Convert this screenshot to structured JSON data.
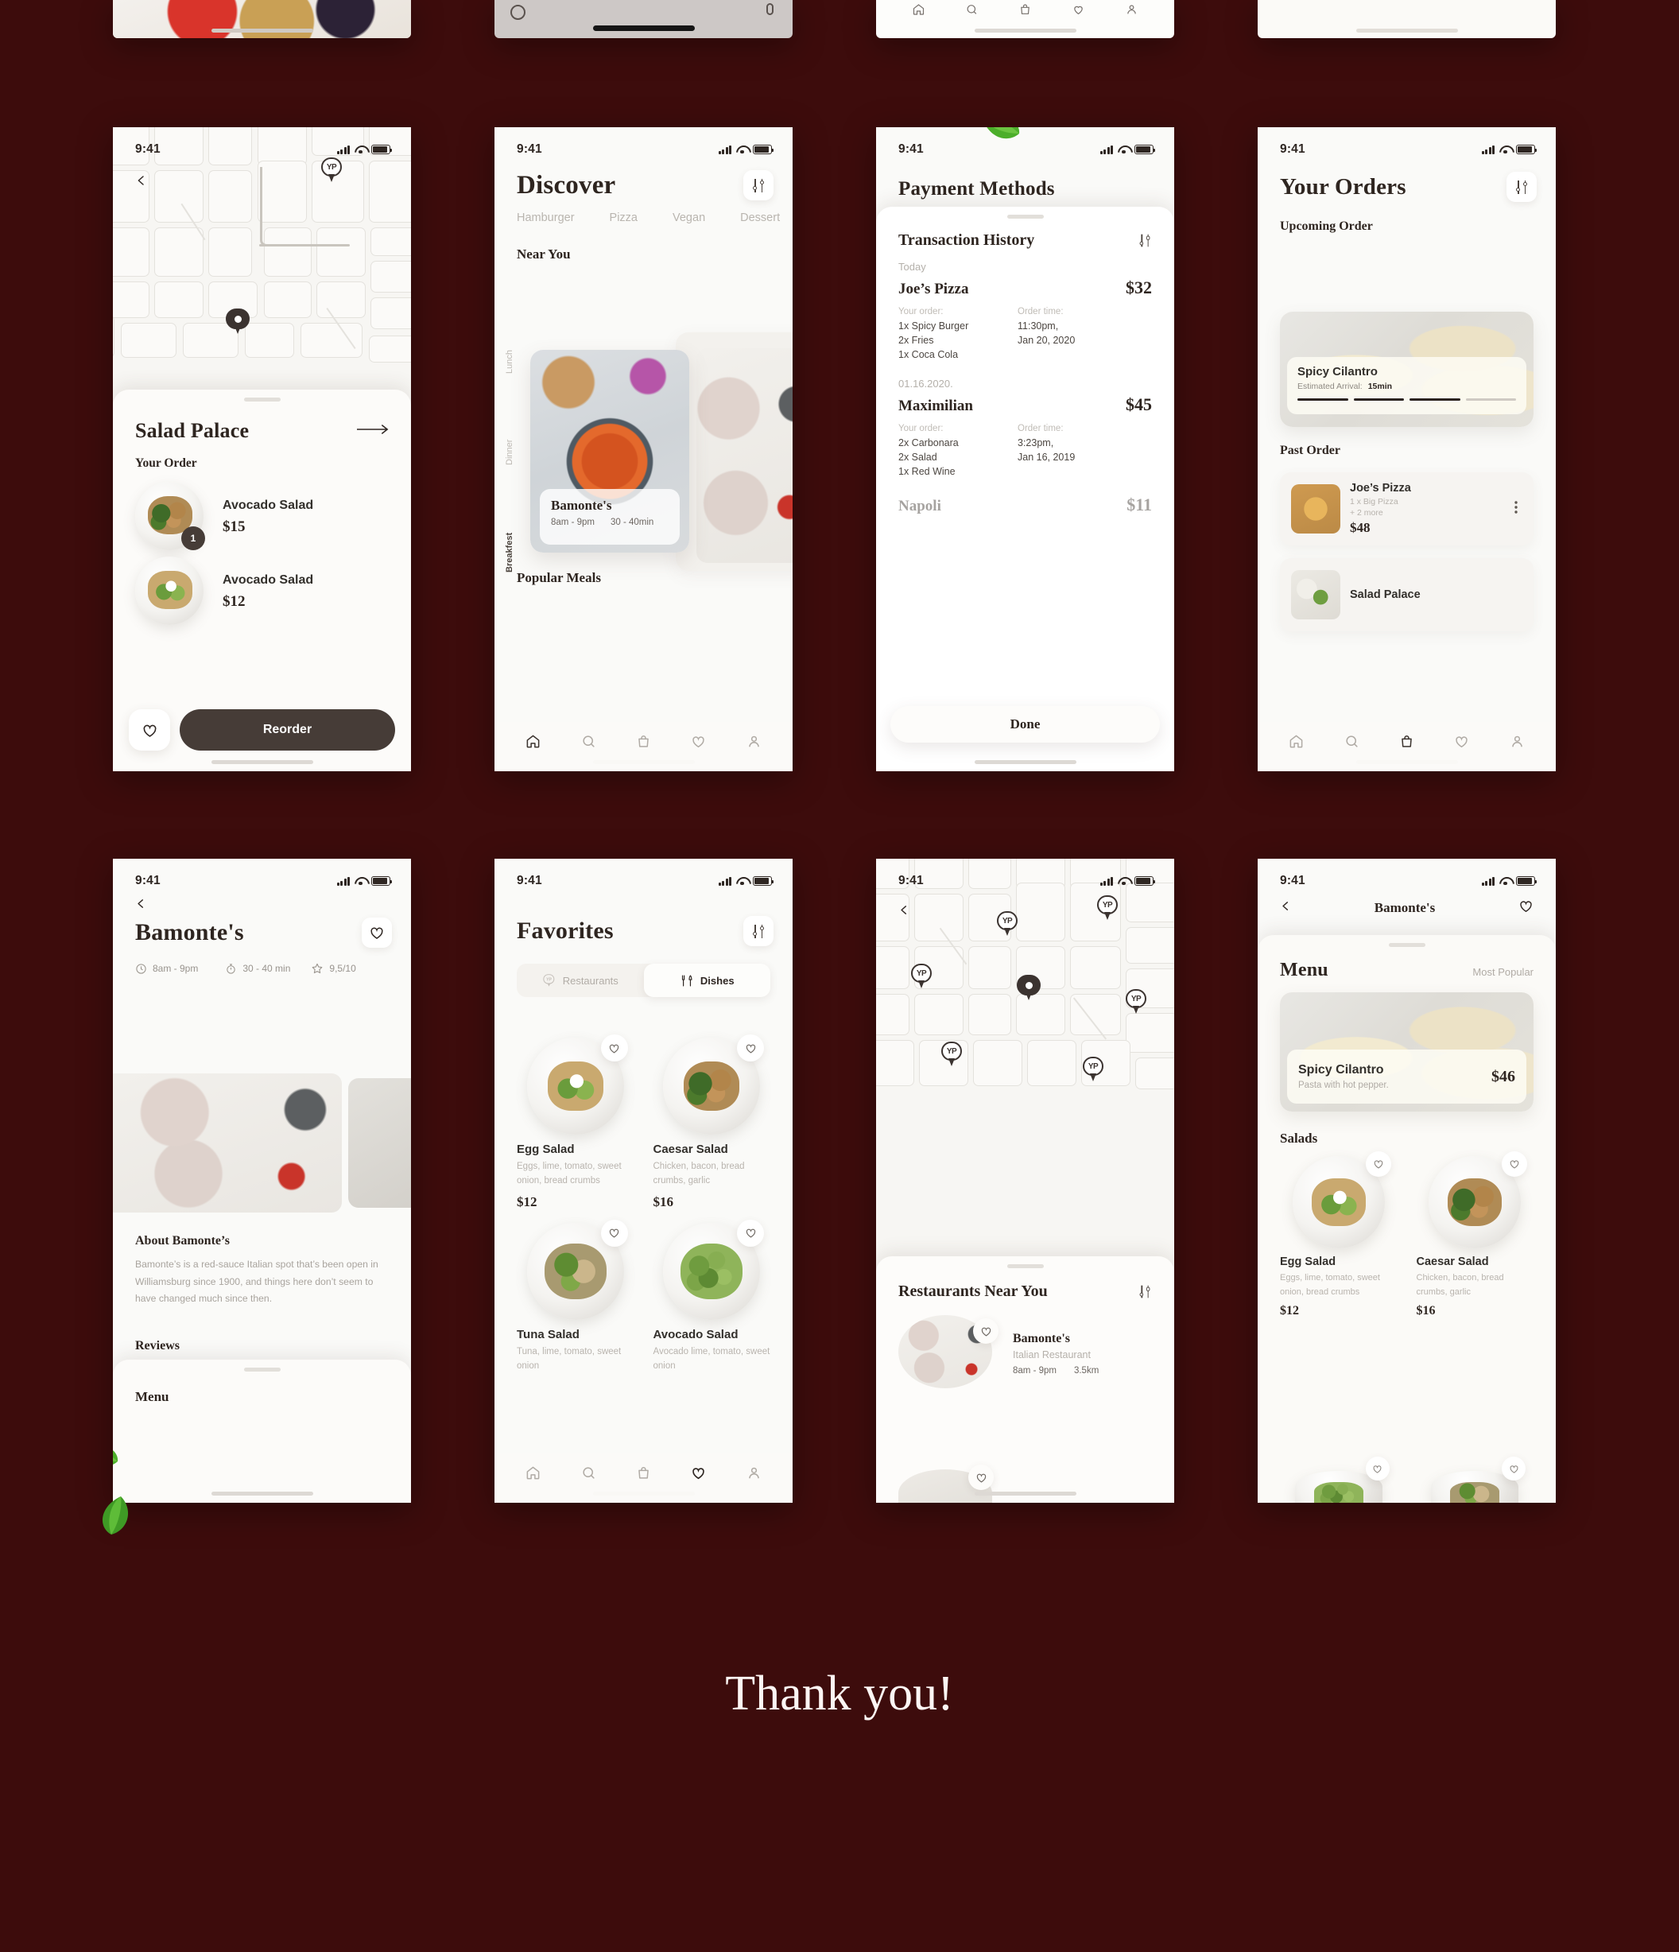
{
  "meta": {
    "background_color": "#3d0c0c",
    "accent_dark": "#3b3330",
    "status_time": "9:41",
    "thank_you": "Thank you!"
  },
  "screen_salad_palace": {
    "back_icon": "chevron-left-icon",
    "map_pin_label": "YP",
    "restaurant": "Salad Palace",
    "arrow": "→",
    "section": "Your Order",
    "items": [
      {
        "name": "Avocado Salad",
        "price": "$15",
        "qty": "1"
      },
      {
        "name": "Avocado Salad",
        "price": "$12",
        "qty": ""
      }
    ],
    "reorder_label": "Reorder",
    "fav_icon": "heart-icon"
  },
  "screen_discover": {
    "title": "Discover",
    "filter_icon": "filters-icon",
    "categories": [
      "Hamburger",
      "Pizza",
      "Vegan",
      "Dessert"
    ],
    "side_labels": [
      "Lunch",
      "Dinner",
      "Breakfest"
    ],
    "near_you": "Near You",
    "card": {
      "name": "Bamonte's",
      "hours": "8am - 9pm",
      "delivery": "30 - 40min"
    },
    "popular": "Popular Meals",
    "tabs": [
      "home-icon",
      "search-icon",
      "bag-icon",
      "heart-icon",
      "profile-icon"
    ],
    "active_tab": "home-icon"
  },
  "screen_payment": {
    "title": "Payment Methods",
    "section": "Transaction History",
    "filter_icon": "filters-icon",
    "groups": [
      {
        "date": "Today",
        "merchant": "Joe’s Pizza",
        "total": "$32",
        "order_label": "Your order:",
        "time_label": "Order time:",
        "items": [
          "1x Spicy Burger",
          "2x Fries",
          "1x Coca Cola"
        ],
        "time": [
          "11:30pm,",
          "Jan 20, 2020"
        ]
      },
      {
        "date": "01.16.2020.",
        "merchant": "Maximilian",
        "total": "$45",
        "order_label": "Your order:",
        "time_label": "Order time:",
        "items": [
          "2x Carbonara",
          "2x Salad",
          "1x Red Wine"
        ],
        "time": [
          "3:23pm,",
          "Jan 16, 2019"
        ]
      }
    ],
    "partial": {
      "merchant": "Napoli",
      "total": "$11"
    },
    "done_label": "Done"
  },
  "screen_orders": {
    "title": "Your Orders",
    "filter_icon": "filters-icon",
    "upcoming_label": "Upcoming Order",
    "upcoming": {
      "dish": "Spicy Cilantro",
      "eta_label": "Estimated Arrival:",
      "eta_value": "15min",
      "progress_steps": 4,
      "progress_done": 3
    },
    "past_label": "Past Order",
    "past": [
      {
        "name": "Joe’s Pizza",
        "detail1": "1 x Big Pizza",
        "detail2": "+ 2 more",
        "price": "$48",
        "menu_icon": "more-vertical-icon"
      },
      {
        "name": "Salad Palace",
        "detail1": "",
        "detail2": "",
        "price": "",
        "menu_icon": "more-vertical-icon"
      }
    ],
    "tabs": [
      "home-icon",
      "search-icon",
      "bag-icon",
      "heart-icon",
      "profile-icon"
    ],
    "active_tab": "bag-icon"
  },
  "screen_restaurant": {
    "back_icon": "chevron-left-icon",
    "title": "Bamonte's",
    "fav_icon": "heart-icon",
    "info": [
      {
        "icon": "clock-icon",
        "value": "8am - 9pm"
      },
      {
        "icon": "timer-icon",
        "value": "30 - 40 min"
      },
      {
        "icon": "star-icon",
        "value": "9,5/10"
      }
    ],
    "about_title": "About Bamonte’s",
    "about_text": "Bamonte’s is a red-sauce Italian spot that’s been open in Williamsburg since 1900, and things here don’t seem to have changed much since then.",
    "reviews_title": "Reviews",
    "menu_title": "Menu"
  },
  "screen_favorites": {
    "title": "Favorites",
    "filter_icon": "filters-icon",
    "toggle": [
      {
        "label": "Restaurants",
        "icon": "yp-pin-icon",
        "active": false
      },
      {
        "label": "Dishes",
        "icon": "cutlery-icon",
        "active": true
      }
    ],
    "dishes": [
      {
        "name": "Egg Salad",
        "desc": "Eggs, lime, tomato, sweet onion, bread crumbs",
        "price": "$12",
        "plate": "toast"
      },
      {
        "name": "Caesar Salad",
        "desc": "Chicken, bacon, bread crumbs, garlic",
        "price": "$16",
        "plate": "chicken"
      },
      {
        "name": "Tuna Salad",
        "desc": "Tuna, lime, tomato, sweet onion",
        "price": "",
        "plate": "tuna"
      },
      {
        "name": "Avocado Salad",
        "desc": "Avocado lime, tomato, sweet onion",
        "price": "",
        "plate": "greens"
      }
    ],
    "tabs": [
      "home-icon",
      "search-icon",
      "bag-icon",
      "heart-icon",
      "profile-icon"
    ],
    "active_tab": "heart-icon"
  },
  "screen_nearby": {
    "back_icon": "chevron-left-icon",
    "pin_label": "YP",
    "pin_count": 6,
    "title": "Restaurants Near You",
    "filter_icon": "filters-icon",
    "list": [
      {
        "name": "Bamonte's",
        "type": "Italian Restaurant",
        "hours": "8am - 9pm",
        "distance": "3.5km",
        "fav_icon": "heart-icon"
      }
    ]
  },
  "screen_menu": {
    "back_icon": "chevron-left-icon",
    "title": "Bamonte's",
    "fav_icon": "heart-icon",
    "menu_title": "Menu",
    "menu_sort": "Most Popular",
    "featured": {
      "name": "Spicy Cilantro",
      "desc": "Pasta with hot pepper.",
      "price": "$46"
    },
    "section_title": "Salads",
    "dishes": [
      {
        "name": "Egg Salad",
        "desc": "Eggs, lime, tomato, sweet onion, bread crumbs",
        "price": "$12",
        "plate": "toast"
      },
      {
        "name": "Caesar Salad",
        "desc": "Chicken, bacon, bread crumbs, garlic",
        "price": "$16",
        "plate": "chicken"
      }
    ]
  }
}
